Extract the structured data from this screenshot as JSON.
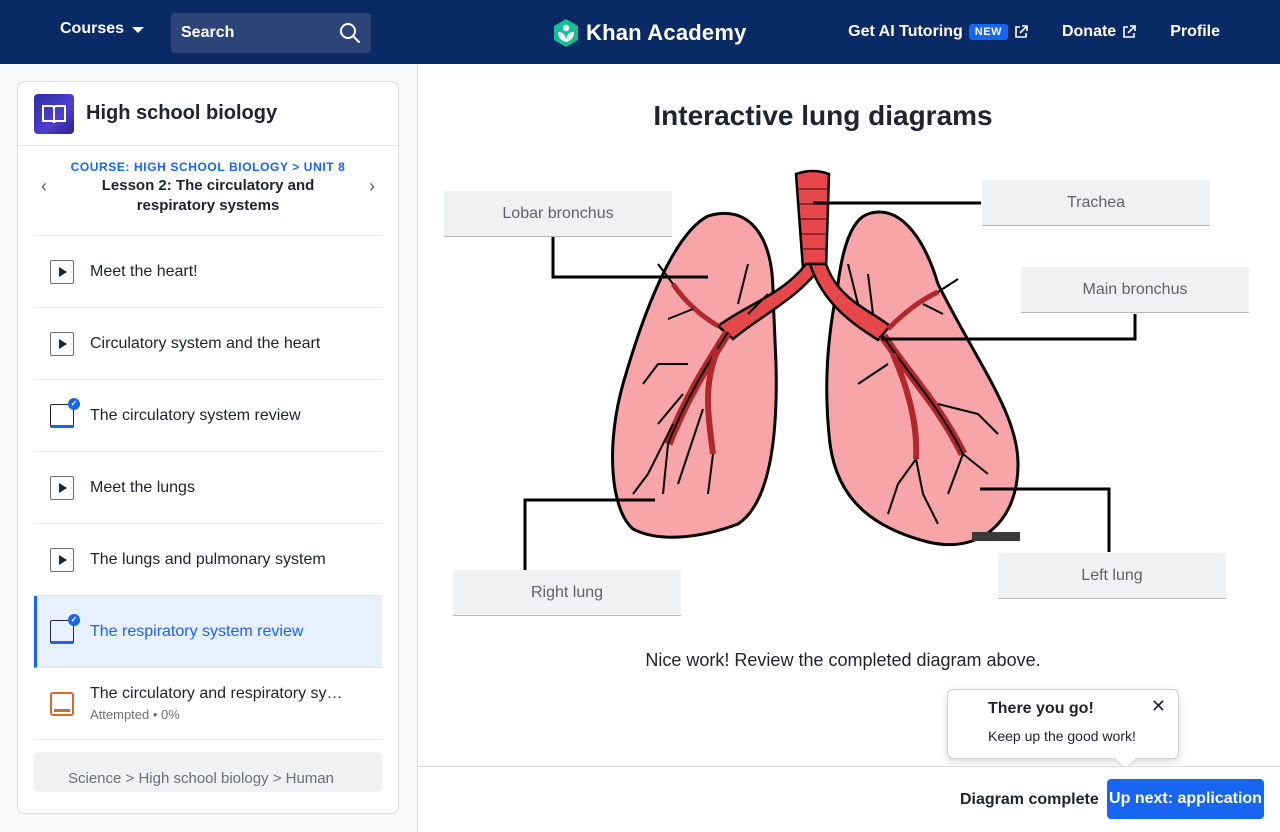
{
  "header": {
    "courses_label": "Courses",
    "search_label": "Search",
    "brand": "Khan Academy",
    "ai_tutoring": "Get AI Tutoring",
    "new_badge": "NEW",
    "donate": "Donate",
    "profile": "Profile"
  },
  "sidebar": {
    "course_title": "High school biology",
    "breadcrumb": "COURSE: HIGH SCHOOL BIOLOGY > UNIT 8",
    "lesson_title": "Lesson 2: The circulatory and respiratory systems",
    "items": [
      {
        "label": "Meet the heart!",
        "type": "video"
      },
      {
        "label": "Circulatory system and the heart",
        "type": "video"
      },
      {
        "label": "The circulatory system review",
        "type": "article"
      },
      {
        "label": "Meet the lungs",
        "type": "video"
      },
      {
        "label": "The lungs and pulmonary system",
        "type": "video"
      },
      {
        "label": "The respiratory system review",
        "type": "article"
      },
      {
        "label": "The circulatory and respiratory systems",
        "type": "quiz",
        "sub": "Attempted • 0%"
      }
    ],
    "footer_breadcrumb": "Science > High school biology > Human"
  },
  "main": {
    "title": "Interactive lung diagrams",
    "labels": {
      "lobar_bronchus": "Lobar bronchus",
      "trachea": "Trachea",
      "main_bronchus": "Main bronchus",
      "right_lung": "Right lung",
      "left_lung": "Left lung"
    },
    "feedback": "Nice work! Review the completed diagram above.",
    "popover": {
      "title": "There you go!",
      "body": "Keep up the good work!"
    },
    "status": "Diagram complete",
    "next_button": "Up next: application"
  },
  "colors": {
    "header_bg": "#0a2a66",
    "accent": "#1865f2",
    "lung_fill": "#f7a5a8",
    "airway_fill": "#e5474b"
  }
}
